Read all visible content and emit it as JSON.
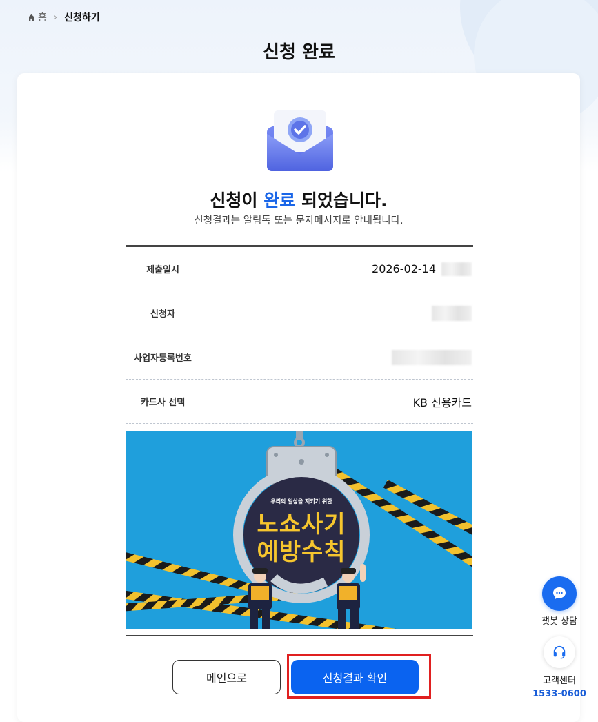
{
  "breadcrumb": {
    "home": "홈",
    "current": "신청하기"
  },
  "page_title": "신청 완료",
  "result": {
    "title_pre": "신청이 ",
    "title_accent": "완료",
    "title_post": " 되었습니다.",
    "subtitle": "신청결과는 알림톡 또는 문자메시지로 안내됩니다."
  },
  "info_rows": [
    {
      "label": "제출일시",
      "value": "2026-02-14"
    },
    {
      "label": "신청자",
      "value": ""
    },
    {
      "label": "사업자등록번호",
      "value": ""
    },
    {
      "label": "카드사 선택",
      "value": "KB 신용카드"
    }
  ],
  "banner": {
    "small_text": "우리의 일상을 지키기 위한",
    "line1": "노쇼사기",
    "line2": "예방수칙"
  },
  "buttons": {
    "main": "메인으로",
    "confirm": "신청결과 확인"
  },
  "side": {
    "chatbot": "챗봇 상담",
    "customer_center": "고객센터",
    "phone": "1533-0600"
  },
  "colors": {
    "accent": "#1a66e8",
    "primary_button": "#0a63f0",
    "banner_bg": "#1f9fdc",
    "highlight": "#e02020"
  }
}
